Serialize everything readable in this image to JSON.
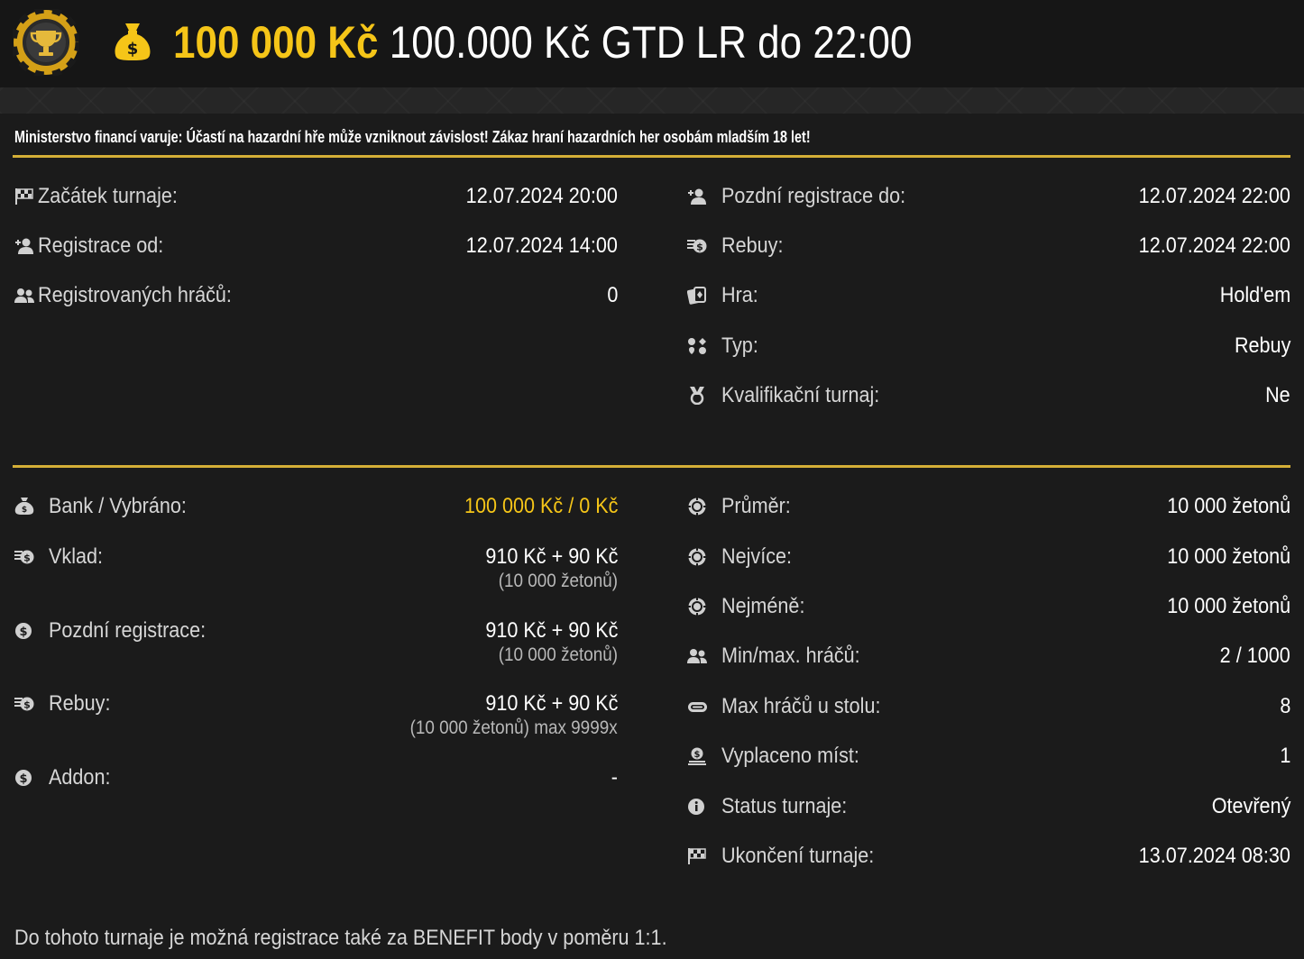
{
  "header": {
    "amount": "100 000 Kč",
    "name": "100.000 Kč GTD LR do 22:00",
    "logo_icon": "trophy-chip-icon",
    "bag_icon": "money-bag-icon"
  },
  "warning": "Ministerstvo financí varuje: Účastí na hazardní hře může vzniknout závislost! Zákaz hraní hazardních her osobám mladším 18 let!",
  "section1": {
    "left": [
      {
        "label": "Začátek turnaje:",
        "value": "12.07.2024 20:00"
      },
      {
        "label": "Registrace od:",
        "value": "12.07.2024 14:00"
      },
      {
        "label": "Registrovaných hráčů:",
        "value": "0"
      }
    ],
    "right": [
      {
        "label": "Pozdní registrace do:",
        "value": "12.07.2024 22:00"
      },
      {
        "label": "Rebuy:",
        "value": "12.07.2024 22:00"
      },
      {
        "label": "Hra:",
        "value": "Hold'em"
      },
      {
        "label": "Typ:",
        "value": "Rebuy"
      },
      {
        "label": "Kvalifikační turnaj:",
        "value": "Ne"
      }
    ]
  },
  "section2": {
    "left": [
      {
        "label": "Bank / Vybráno:",
        "value": "100 000 Kč / 0 Kč"
      },
      {
        "label": "Vklad:",
        "value": "910 Kč + 90 Kč",
        "sub": "(10 000 žetonů)"
      },
      {
        "label": "Pozdní registrace:",
        "value": "910 Kč + 90 Kč",
        "sub": "(10 000 žetonů)"
      },
      {
        "label": "Rebuy:",
        "value": "910 Kč + 90 Kč",
        "sub": "(10 000 žetonů) max 9999x"
      },
      {
        "label": "Addon:",
        "value": "-"
      }
    ],
    "right": [
      {
        "label": "Průměr:",
        "value": "10 000 žetonů"
      },
      {
        "label": "Nejvíce:",
        "value": "10 000 žetonů"
      },
      {
        "label": "Nejméně:",
        "value": "10 000 žetonů"
      },
      {
        "label": "Min/max. hráčů:",
        "value": "2 / 1000"
      },
      {
        "label": "Max hráčů u stolu:",
        "value": "8"
      },
      {
        "label": "Vyplaceno míst:",
        "value": "1"
      },
      {
        "label": "Status turnaje:",
        "value": "Otevřený"
      },
      {
        "label": "Ukončení turnaje:",
        "value": "13.07.2024 08:30"
      }
    ]
  },
  "footer": "Do tohoto turnaje je možná registrace také za BENEFIT body v poměru 1:1.",
  "colors": {
    "accent": "#f5c518",
    "divider": "#d4af37",
    "background": "#1b1b1b"
  }
}
